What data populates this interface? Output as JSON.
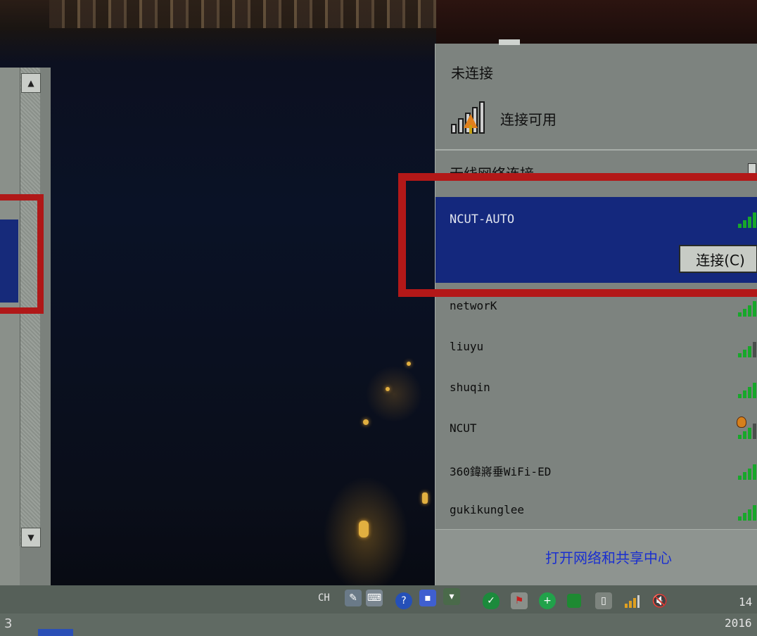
{
  "status": {
    "title": "未连接",
    "available": "连接可用"
  },
  "section": {
    "title": "无线网络连接"
  },
  "selected_network": {
    "ssid": "NCUT-AUTO",
    "connect_label": "连接(C)"
  },
  "networks": [
    {
      "ssid": "networK",
      "signal_bars": 4,
      "secured": false
    },
    {
      "ssid": "liuyu",
      "signal_bars": 3,
      "secured": false
    },
    {
      "ssid": "shuqin",
      "signal_bars": 4,
      "secured": false
    },
    {
      "ssid": "NCUT",
      "signal_bars": 3,
      "secured": true
    },
    {
      "ssid": "360鍏嶈垂WiFi-ED",
      "signal_bars": 4,
      "secured": false
    },
    {
      "ssid": "gukikunglee",
      "signal_bars": 4,
      "secured": false
    }
  ],
  "footer": {
    "link": "打开网络和共享中心"
  },
  "taskbar": {
    "left_number": "3",
    "language": "CH",
    "clock_time": "14",
    "clock_date": "2016"
  },
  "colors": {
    "highlight": "#14287d",
    "signal": "#17a82a",
    "annotation_red": "#b31818",
    "link": "#1a2fd0"
  }
}
